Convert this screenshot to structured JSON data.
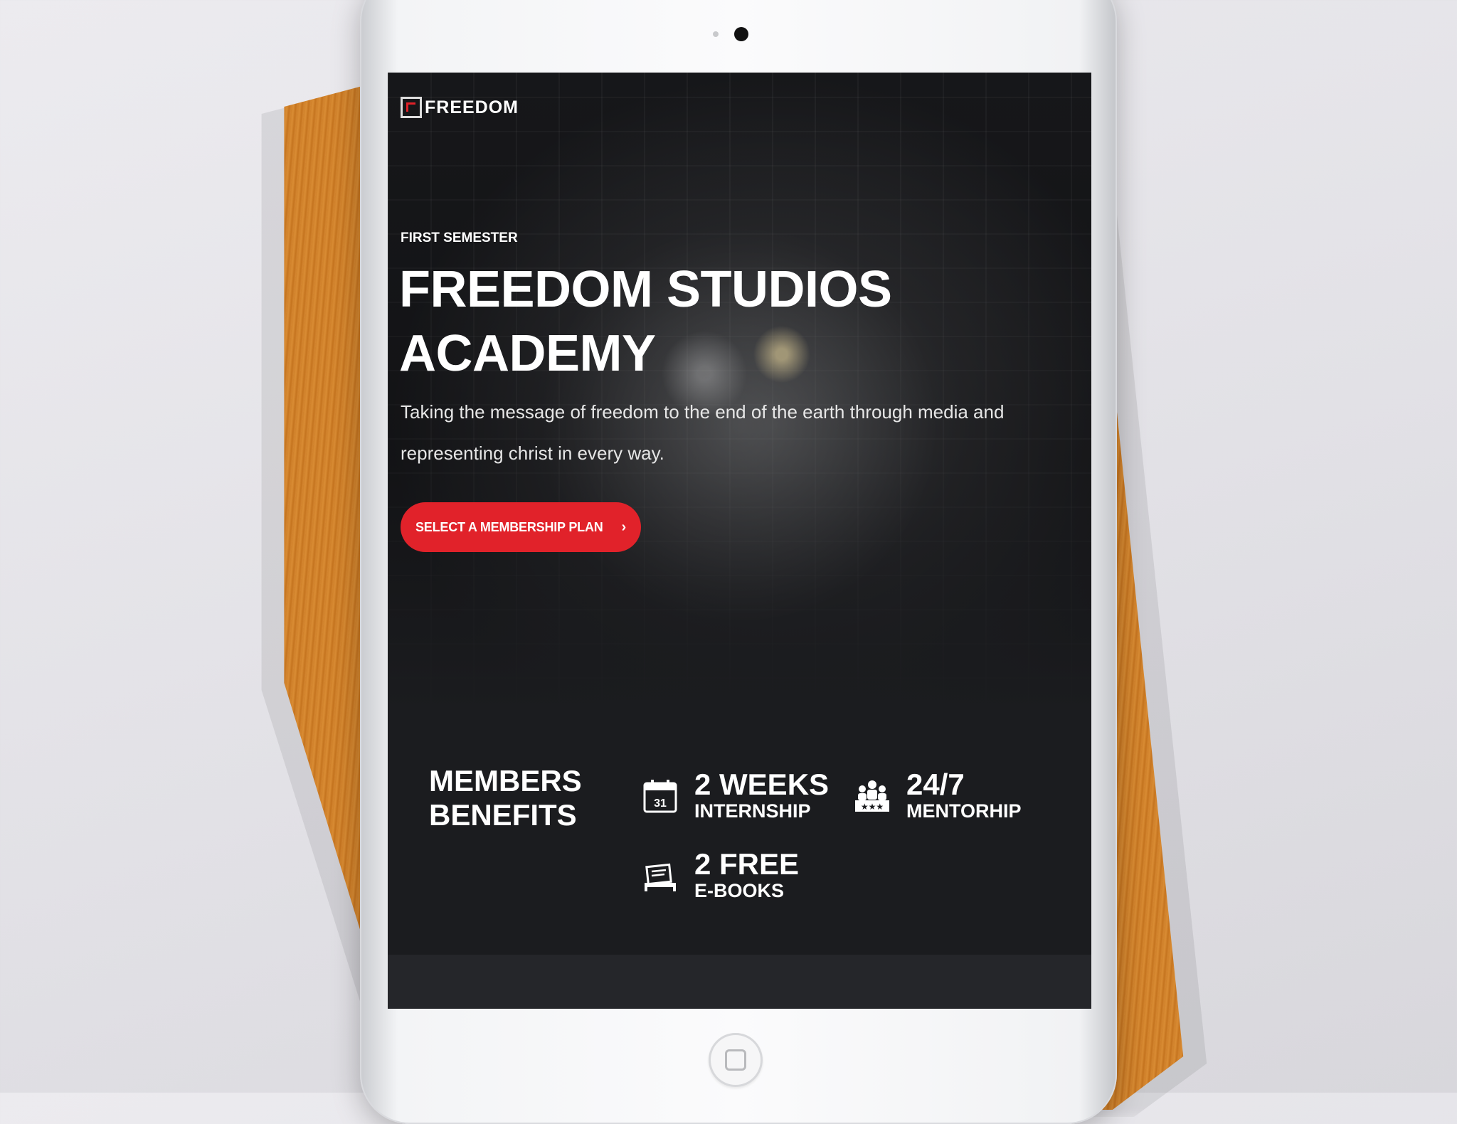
{
  "brand": {
    "logo_text": "FREEDOM"
  },
  "hero": {
    "eyebrow": "FIRST SEMESTER",
    "title": "FREEDOM STUDIOS ACADEMY",
    "subtitle": "Taking the message of freedom to the end of the earth through media and representing christ in every way.",
    "cta_label": "SELECT A MEMBERSHIP PLAN",
    "cta_icon": "chevron-right-icon"
  },
  "benefits": {
    "heading_line1": "MEMBERS",
    "heading_line2": "BENEFITS",
    "items": [
      {
        "icon": "calendar-icon",
        "icon_text": "31",
        "value": "2 WEEKS",
        "label": "INTERNSHIP"
      },
      {
        "icon": "mentorship-group-icon",
        "value": "24/7",
        "label": "MENTORHIP"
      },
      {
        "icon": "ebook-reader-icon",
        "value": "2 FREE",
        "label": "E-BOOKS"
      }
    ]
  },
  "colors": {
    "accent": "#e1222a",
    "screen_bg": "#1b1c1f",
    "text": "#ffffff"
  }
}
